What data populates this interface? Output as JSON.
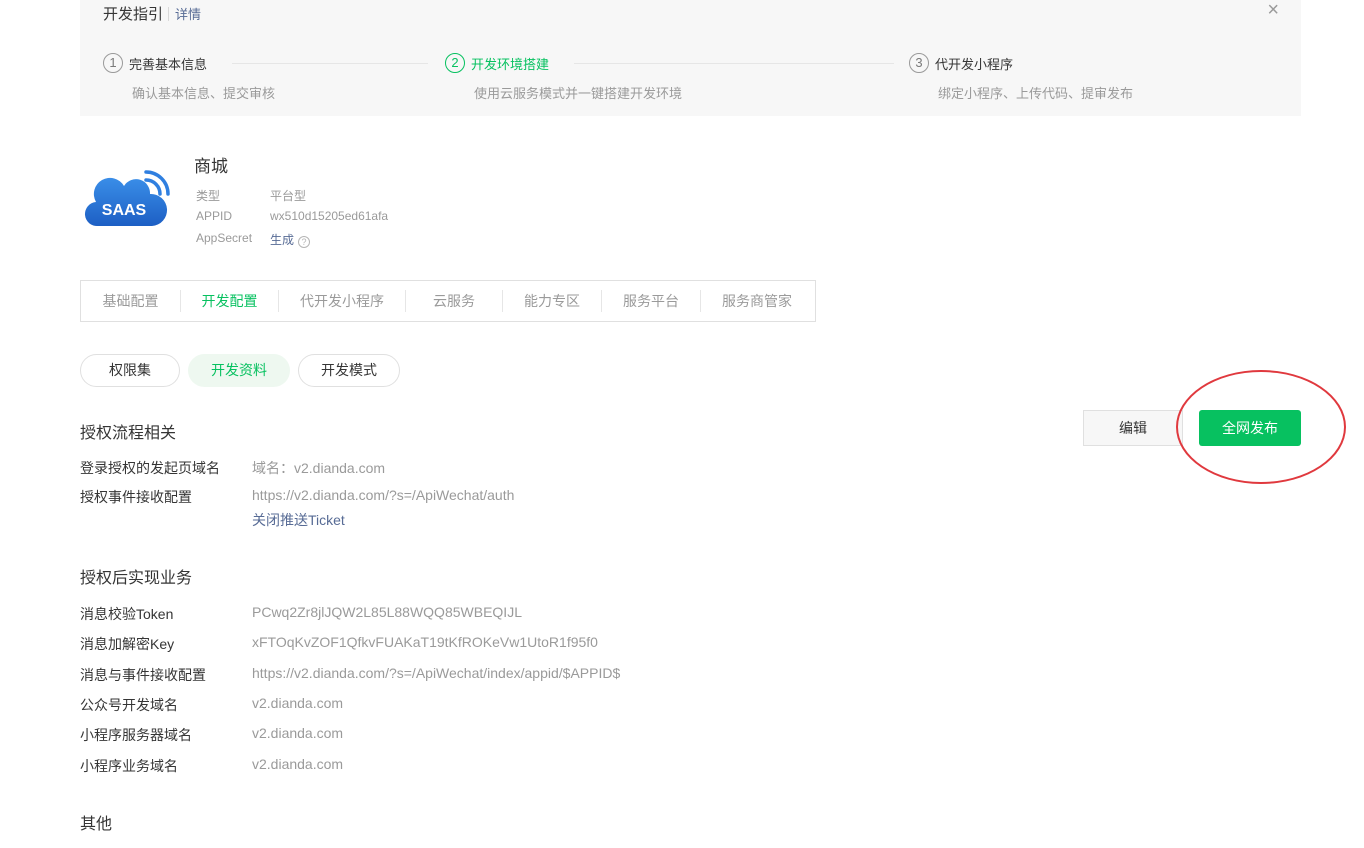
{
  "guide": {
    "title": "开发指引",
    "detail_link": "详情",
    "close_glyph": "×",
    "steps": [
      {
        "num": "1",
        "label": "完善基本信息",
        "desc": "确认基本信息、提交审核"
      },
      {
        "num": "2",
        "label": "开发环境搭建",
        "desc": "使用云服务模式并一键搭建开发环境"
      },
      {
        "num": "3",
        "label": "代开发小程序",
        "desc": "绑定小程序、上传代码、提审发布"
      }
    ]
  },
  "app": {
    "logo_text": "SAAS",
    "name": "商城",
    "type_label": "类型",
    "type_value": "平台型",
    "appid_label": "APPID",
    "appid_value": "wx510d15205ed61afa",
    "secret_label": "AppSecret",
    "secret_value": "生成",
    "help_glyph": "?"
  },
  "tabs": [
    "基础配置",
    "开发配置",
    "代开发小程序",
    "云服务",
    "能力专区",
    "服务平台",
    "服务商管家"
  ],
  "pills": [
    "权限集",
    "开发资料",
    "开发模式"
  ],
  "section_auth": {
    "title": "授权流程相关",
    "edit_button": "编辑",
    "publish_button": "全网发布",
    "rows": [
      {
        "key": "登录授权的发起页域名",
        "value": "域名：v2.dianda.com"
      },
      {
        "key": "授权事件接收配置",
        "value": "https://v2.dianda.com/?s=/ApiWechat/auth",
        "link": "关闭推送Ticket"
      }
    ]
  },
  "section_business": {
    "title": "授权后实现业务",
    "rows": [
      {
        "key": "消息校验Token",
        "value": "PCwq2Zr8jlJQW2L85L88WQQ85WBEQIJL"
      },
      {
        "key": "消息加解密Key",
        "value": "xFTOqKvZOF1QfkvFUAKaT19tKfROKeVw1UtoR1f95f0"
      },
      {
        "key": "消息与事件接收配置",
        "value": "https://v2.dianda.com/?s=/ApiWechat/index/appid/$APPID$"
      },
      {
        "key": "公众号开发域名",
        "value": "v2.dianda.com"
      },
      {
        "key": "小程序服务器域名",
        "value": "v2.dianda.com"
      },
      {
        "key": "小程序业务域名",
        "value": "v2.dianda.com"
      }
    ]
  },
  "section_other": {
    "title": "其他"
  },
  "colors": {
    "accent": "#07c160",
    "link": "#576b95",
    "annotation": "#e0393e"
  }
}
